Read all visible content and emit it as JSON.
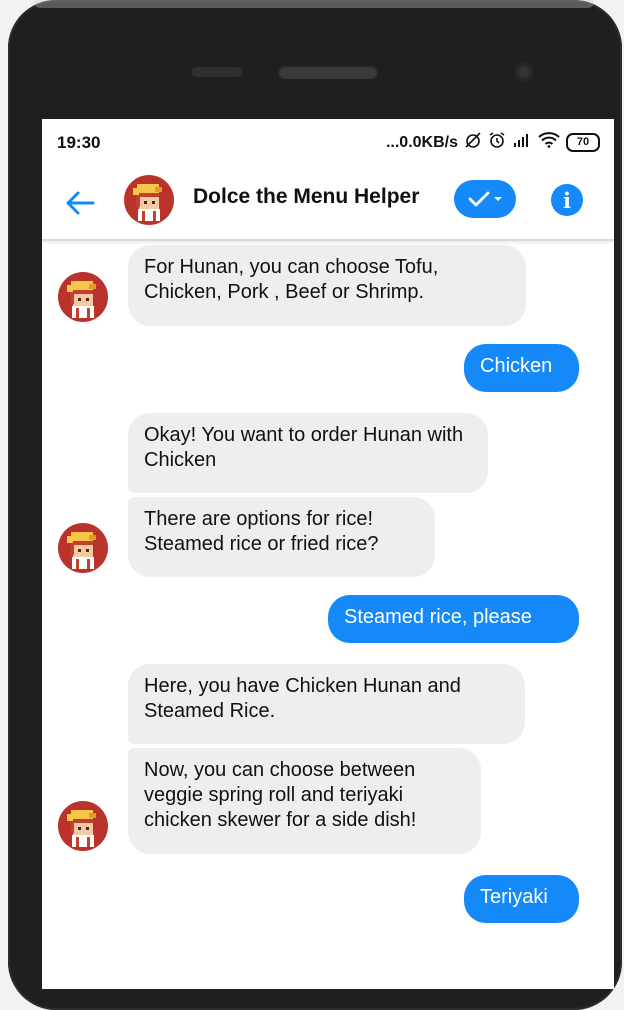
{
  "status": {
    "time": "19:30",
    "net_speed": "...0.0KB/s",
    "battery": "70"
  },
  "header": {
    "title": "Dolce the Menu Helper"
  },
  "messages": [
    {
      "from": "bot",
      "text": "For Hunan, you can choose Tofu, Chicken, Pork , Beef or Shrimp."
    },
    {
      "from": "user",
      "text": "Chicken"
    },
    {
      "from": "bot",
      "text": "Okay!  You want to order Hunan with Chicken"
    },
    {
      "from": "bot",
      "text": "There are options for rice! Steamed rice or fried rice?"
    },
    {
      "from": "user",
      "text": "Steamed rice, please"
    },
    {
      "from": "bot",
      "text": "Here, you have Chicken Hunan and Steamed Rice."
    },
    {
      "from": "bot",
      "text": "Now, you can choose between veggie spring roll and teriyaki chicken skewer for a side dish!"
    },
    {
      "from": "user",
      "text": "Teriyaki"
    }
  ],
  "colors": {
    "accent": "#1589f7",
    "bot_bubble": "#eeeeee",
    "phone_body": "#1f1f1f"
  }
}
